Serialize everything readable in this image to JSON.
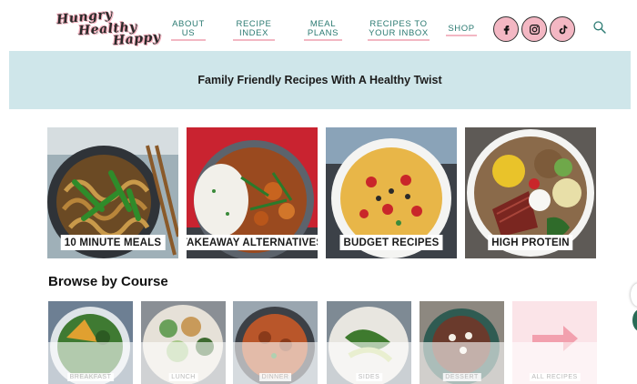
{
  "header": {
    "logo": [
      "Hungry",
      "Healthy",
      "Happy"
    ],
    "nav": [
      {
        "label_1": "ABOUT",
        "label_2": "US"
      },
      {
        "label_1": "RECIPE",
        "label_2": "INDEX"
      },
      {
        "label_1": "MEAL",
        "label_2": "PLANS"
      },
      {
        "label_1": "RECIPES TO",
        "label_2": "YOUR INBOX"
      },
      {
        "label_1": "SHOP",
        "label_2": ""
      }
    ],
    "social_icons": [
      "facebook-icon",
      "instagram-icon",
      "tiktok-icon"
    ],
    "search_icon": "search-icon"
  },
  "banner": {
    "text": "Family Friendly Recipes With A Healthy Twist"
  },
  "categories": [
    {
      "label": "10 MINUTE MEALS"
    },
    {
      "label": "TAKEAWAY ALTERNATIVES"
    },
    {
      "label": "BUDGET RECIPES"
    },
    {
      "label": "HIGH PROTEIN"
    }
  ],
  "browse": {
    "title": "Browse by Course",
    "courses": [
      {
        "label": "BREAKFAST"
      },
      {
        "label": "LUNCH"
      },
      {
        "label": "DINNER"
      },
      {
        "label": "SIDES"
      },
      {
        "label": "DESSERT"
      },
      {
        "label": "ALL RECIPES"
      }
    ]
  },
  "colors": {
    "accent_teal": "#2b7a72",
    "accent_pink": "#f3b7c3",
    "banner_bg": "#cfe6ea"
  }
}
